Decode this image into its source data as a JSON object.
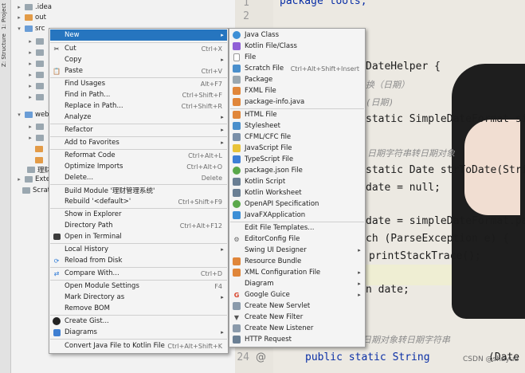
{
  "toolstrip": {
    "project_label": "1: Project",
    "structure_label": "Z: Structure"
  },
  "tree": {
    "items": [
      {
        "label": ".idea"
      },
      {
        "label": "out"
      },
      {
        "label": "src"
      },
      {
        "label": "web"
      },
      {
        "label": "理财"
      },
      {
        "label": "Extern"
      },
      {
        "label": "Scratcl"
      }
    ]
  },
  "editor": {
    "line_numbers": [
      "1",
      "2",
      "24"
    ],
    "code_lines": [
      "package tools;",
      "DateHelper {",
      "换（日期）",
      "(日期)",
      "static SimpleDateFormat sim",
      "日期字符串转日期对象",
      "static Date strToDate(Strin",
      "date = null;",
      "date = simpleDateFormat.par",
      "ch (ParseException e) {",
      "printStackTrace();",
      "n date;",
      "日期对象转日期字符串",
      "public static String",
      "(Date"
    ],
    "watermark": "CSDN @shayua"
  },
  "menu1": {
    "items": [
      {
        "label": "New",
        "icon": "none",
        "arrow": "▸"
      },
      {
        "label": "Cut",
        "icon": "scissors-icon",
        "shortcut": "Ctrl+X"
      },
      {
        "label": "Copy",
        "icon": "none",
        "arrow": "▸"
      },
      {
        "label": "Paste",
        "icon": "clipboard-icon",
        "shortcut": "Ctrl+V"
      },
      {
        "label": "Find Usages",
        "shortcut": "Alt+F7"
      },
      {
        "label": "Find in Path...",
        "shortcut": "Ctrl+Shift+F"
      },
      {
        "label": "Replace in Path...",
        "shortcut": "Ctrl+Shift+R"
      },
      {
        "label": "Analyze",
        "arrow": "▸"
      },
      {
        "label": "Refactor",
        "arrow": "▸"
      },
      {
        "label": "Add to Favorites",
        "arrow": "▸"
      },
      {
        "label": "Reformat Code",
        "shortcut": "Ctrl+Alt+L"
      },
      {
        "label": "Optimize Imports",
        "shortcut": "Ctrl+Alt+O"
      },
      {
        "label": "Delete...",
        "shortcut": "Delete"
      },
      {
        "label": "Build Module '理财管理系统'"
      },
      {
        "label": "Rebuild '<default>'",
        "shortcut": "Ctrl+Shift+F9"
      },
      {
        "label": "Show in Explorer"
      },
      {
        "label": "Directory Path",
        "shortcut": "Ctrl+Alt+F12"
      },
      {
        "label": "Open in Terminal",
        "icon": "terminal-icon"
      },
      {
        "label": "Local History",
        "arrow": "▸"
      },
      {
        "label": "Reload from Disk",
        "icon": "reload-icon"
      },
      {
        "label": "Compare With...",
        "icon": "compare-icon",
        "shortcut": "Ctrl+D"
      },
      {
        "label": "Open Module Settings",
        "shortcut": "F4"
      },
      {
        "label": "Mark Directory as",
        "arrow": "▸"
      },
      {
        "label": "Remove BOM"
      },
      {
        "label": "Create Gist...",
        "icon": "github-icon"
      },
      {
        "label": "Diagrams",
        "icon": "diagram-icon",
        "arrow": "▸"
      },
      {
        "label": "Convert Java File to Kotlin File",
        "shortcut": "Ctrl+Alt+Shift+K"
      }
    ]
  },
  "menu2": {
    "items": [
      {
        "label": "Java Class"
      },
      {
        "label": "Kotlin File/Class"
      },
      {
        "label": "File"
      },
      {
        "label": "Scratch File",
        "shortcut": "Ctrl+Alt+Shift+Insert"
      },
      {
        "label": "Package"
      },
      {
        "label": "FXML File"
      },
      {
        "label": "package-info.java"
      },
      {
        "label": "HTML File"
      },
      {
        "label": "Stylesheet"
      },
      {
        "label": "CFML/CFC file"
      },
      {
        "label": "JavaScript File"
      },
      {
        "label": "TypeScript File"
      },
      {
        "label": "package.json File"
      },
      {
        "label": "Kotlin Script"
      },
      {
        "label": "Kotlin Worksheet"
      },
      {
        "label": "OpenAPI Specification"
      },
      {
        "label": "JavaFXApplication"
      },
      {
        "label": "Edit File Templates..."
      },
      {
        "label": "EditorConfig File"
      },
      {
        "label": "Swing UI Designer",
        "arrow": "▸"
      },
      {
        "label": "Resource Bundle"
      },
      {
        "label": "XML Configuration File",
        "arrow": "▸"
      },
      {
        "label": "Diagram",
        "arrow": "▸"
      },
      {
        "label": "Google Guice",
        "arrow": "▸"
      },
      {
        "label": "Create New Servlet"
      },
      {
        "label": "Create New Filter"
      },
      {
        "label": "Create New Listener"
      },
      {
        "label": "HTTP Request"
      }
    ]
  },
  "colors": {
    "selection": "#2675bf",
    "menu_bg": "#f4f4f4"
  }
}
